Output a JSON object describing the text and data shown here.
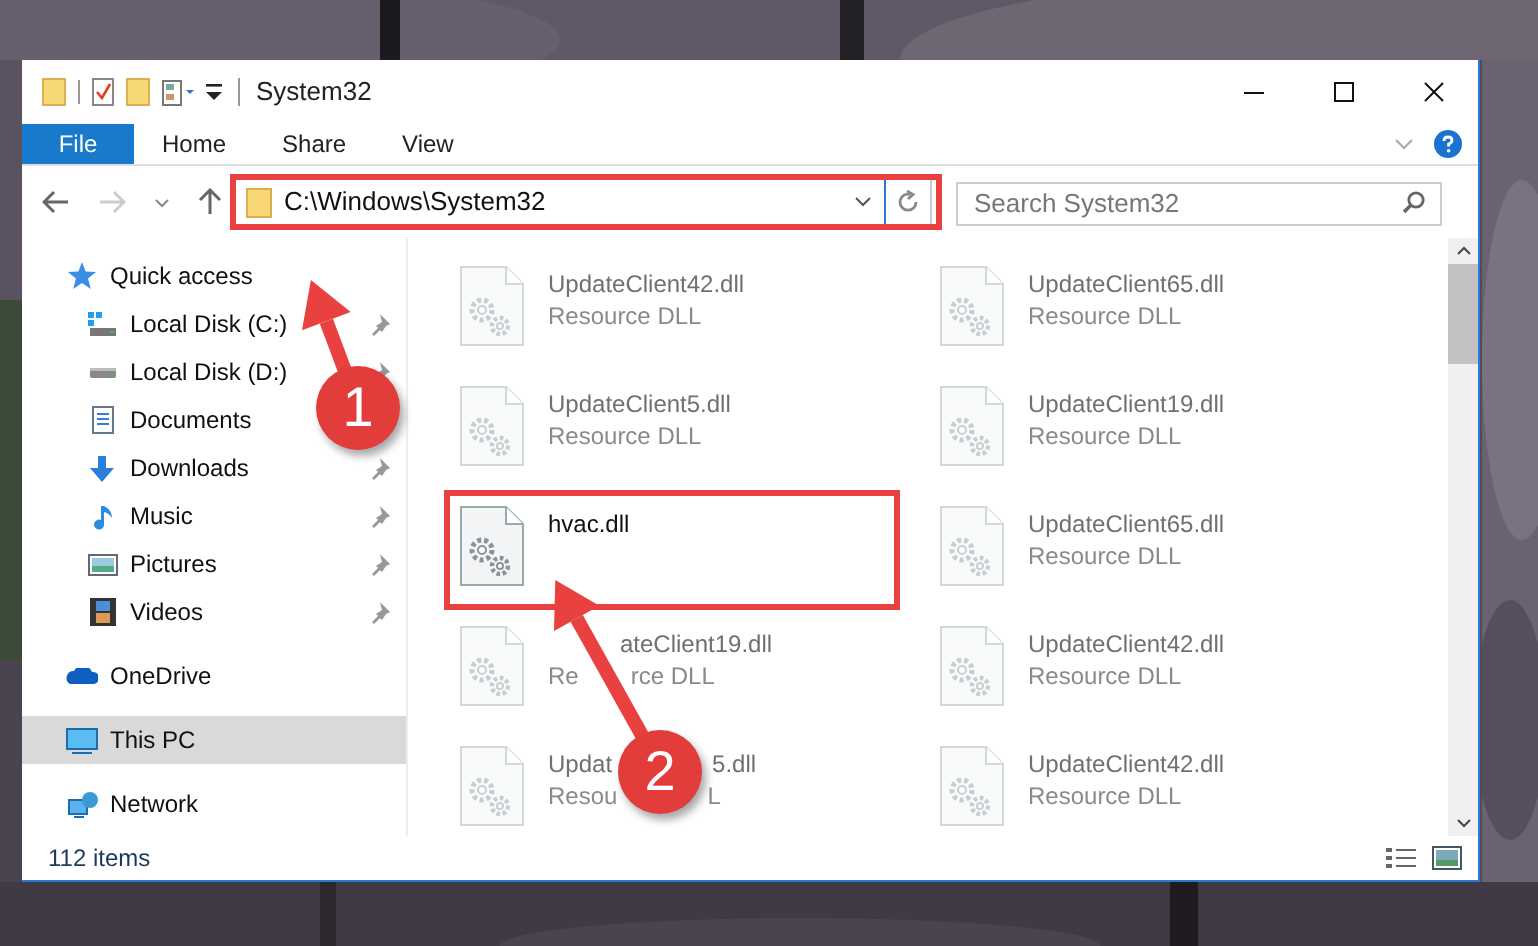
{
  "window": {
    "title": "System32"
  },
  "ribbon": {
    "tabs": [
      {
        "label": "File",
        "selected": true
      },
      {
        "label": "Home",
        "selected": false
      },
      {
        "label": "Share",
        "selected": false
      },
      {
        "label": "View",
        "selected": false
      }
    ]
  },
  "address_bar": {
    "path": "C:\\Windows\\System32",
    "highlighted": true
  },
  "search": {
    "placeholder": "Search System32"
  },
  "nav": [
    {
      "label": "Quick access",
      "kind": "star",
      "selected": false,
      "children": [
        {
          "label": "Local Disk (C:)",
          "kind": "drive-win",
          "pinned": true,
          "selected": false
        },
        {
          "label": "Local Disk (D:)",
          "kind": "drive",
          "pinned": true,
          "selected": false
        },
        {
          "label": "Documents",
          "kind": "documents",
          "selected": false
        },
        {
          "label": "Downloads",
          "kind": "downloads",
          "pinned": true,
          "selected": false
        },
        {
          "label": "Music",
          "kind": "music",
          "pinned": true,
          "selected": false
        },
        {
          "label": "Pictures",
          "kind": "pictures",
          "pinned": true,
          "selected": false
        },
        {
          "label": "Videos",
          "kind": "videos",
          "pinned": true,
          "selected": false
        }
      ]
    },
    {
      "label": "OneDrive",
      "kind": "cloud",
      "selected": false
    },
    {
      "label": "This PC",
      "kind": "pc",
      "selected": true
    },
    {
      "label": "Network",
      "kind": "network",
      "selected": false
    }
  ],
  "files": [
    {
      "name": [
        "UpdateClient42.dll"
      ],
      "type": [
        "Resource DLL"
      ],
      "blurred": true,
      "highlighted": false
    },
    {
      "name": [
        "UpdateClient65.dll"
      ],
      "type": [
        "Resource DLL"
      ],
      "blurred": true,
      "highlighted": false
    },
    {
      "name": [
        "UpdateClient5.dll"
      ],
      "type": [
        "Resource DLL"
      ],
      "blurred": true,
      "highlighted": false
    },
    {
      "name": [
        "UpdateClient19.dll"
      ],
      "type": [
        "Resource DLL"
      ],
      "blurred": true,
      "highlighted": false
    },
    {
      "name": [
        "hvac.dll"
      ],
      "blurred": false,
      "highlighted": true
    },
    {
      "name": [
        "UpdateClient65.dll"
      ],
      "type": [
        "Resource DLL"
      ],
      "blurred": true,
      "highlighted": false
    },
    {
      "name": [
        "ateClient19.dll"
      ],
      "name_start_covered": true,
      "type": [
        "Re",
        "rce DLL"
      ],
      "blurred": true,
      "highlighted": false
    },
    {
      "name": [
        "UpdateClient42.dll"
      ],
      "type": [
        "Resource DLL"
      ],
      "blurred": true,
      "highlighted": false
    },
    {
      "name": [
        "Updat",
        "5.dll"
      ],
      "type": [
        "Resou",
        "L"
      ],
      "blurred": true,
      "highlighted": false
    },
    {
      "name": [
        "UpdateClient42.dll"
      ],
      "type": [
        "Resource DLL"
      ],
      "blurred": true,
      "highlighted": false
    }
  ],
  "status_bar": {
    "item_count": "112 items"
  },
  "annotations": [
    {
      "number": "1"
    },
    {
      "number": "2"
    }
  ]
}
